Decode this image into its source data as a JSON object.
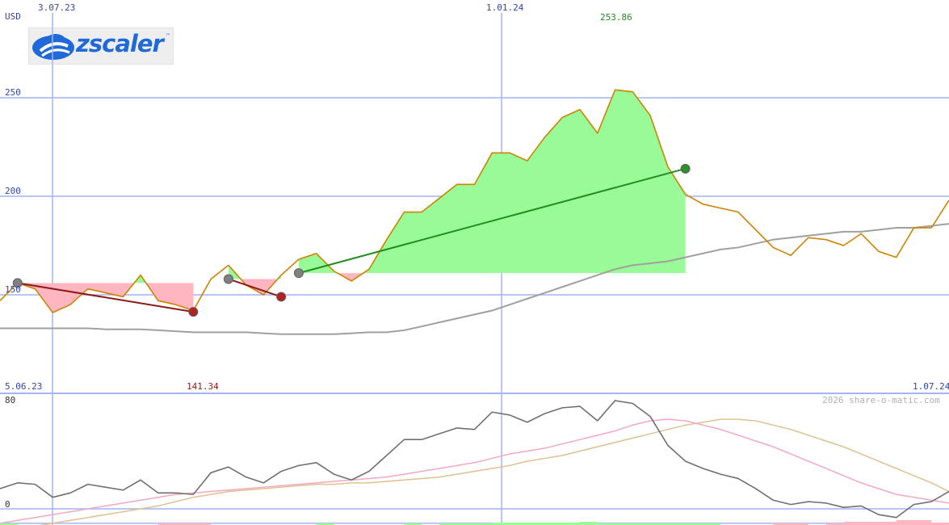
{
  "colors": {
    "price": "#cc8400",
    "gain_fill": "#98fb98",
    "loss_fill": "#ffb6c1",
    "gain_line": "#228b22",
    "loss_line": "#8b1a1a",
    "ma": "#a0a0a0",
    "grid": "#a4b4f4",
    "axis_text": "#3344aa",
    "osc_main": "#707070",
    "osc_pink": "#f4a8c0",
    "osc_tan": "#e0c090"
  },
  "logo": {
    "text": "zscaler",
    "tm": "™",
    "icon": "cloud-logo-icon"
  },
  "labels": {
    "currency": "USD",
    "date_top_left": "3.07.23",
    "date_top_mid": "1.01.24",
    "date_bottom_left": "5.06.23",
    "date_bottom_right": "1.07.24",
    "max_value": "253.86",
    "min_value": "141.34",
    "copyright": "2026 share-o-matic.com"
  },
  "chart_data": [
    {
      "type": "line",
      "title": "",
      "ylabel": "USD",
      "ylim": [
        95,
        297
      ],
      "yticks": [
        150,
        200,
        250
      ],
      "x_date_ticks": [
        "3.07.23",
        "1.01.24"
      ],
      "x_range": [
        "5.06.23",
        "1.07.24"
      ],
      "series": [
        {
          "name": "",
          "role": "price",
          "values": [
            147,
            156,
            153,
            141,
            145,
            153,
            151,
            149,
            160,
            147,
            145,
            142,
            158,
            165,
            155,
            150,
            160,
            168,
            171,
            162,
            157,
            163,
            178,
            192,
            192,
            199,
            206,
            206,
            222,
            222,
            218,
            230,
            240,
            244,
            232,
            254,
            253,
            241,
            215,
            201,
            196,
            194,
            192,
            183,
            174,
            170,
            179,
            178,
            175,
            181,
            172,
            169,
            184,
            184,
            198
          ]
        },
        {
          "name": "",
          "role": "moving-average",
          "values": [
            133,
            133,
            133,
            133,
            133,
            133,
            132.5,
            132.5,
            132.5,
            132,
            131.5,
            131,
            131,
            131,
            131,
            130.5,
            130,
            130,
            130,
            130,
            130.5,
            131,
            131,
            132,
            134,
            136,
            138,
            140,
            142,
            145,
            148,
            151,
            154,
            157,
            160,
            163,
            165,
            166,
            167,
            169,
            171,
            173,
            174,
            176,
            178,
            179,
            180,
            181,
            182,
            182,
            183,
            184,
            184,
            185,
            186
          ]
        }
      ],
      "trades": [
        {
          "from_index": 1,
          "to_index": 11,
          "entry": 156,
          "exit": 141.34,
          "result": "loss"
        },
        {
          "from_index": 13,
          "to_index": 16,
          "entry": 158,
          "exit": 149,
          "result": "loss"
        },
        {
          "from_index": 17,
          "to_index": 39,
          "entry": 161,
          "exit": 214,
          "result": "gain"
        }
      ],
      "annotations": [
        "253.86",
        "141.34"
      ]
    },
    {
      "type": "line",
      "title": "",
      "ylim": [
        -10,
        80
      ],
      "yticks": [
        80,
        0,
        -10
      ],
      "series": [
        {
          "name": "",
          "role": "oscillator",
          "values": [
            14,
            18,
            17,
            8,
            11,
            17,
            15,
            13,
            20,
            11,
            11,
            10,
            25,
            29,
            22,
            18,
            26,
            30,
            32,
            24,
            20,
            26,
            37,
            48,
            48,
            52,
            56,
            55,
            67,
            65,
            60,
            66,
            70,
            71,
            61,
            75,
            73,
            64,
            44,
            33,
            28,
            24,
            21,
            14,
            6,
            3,
            5,
            4,
            1,
            2,
            -4,
            -6,
            3,
            5,
            12
          ]
        },
        {
          "name": "",
          "role": "signal-fast",
          "values": [
            -10,
            -8,
            -6,
            -4,
            -2,
            0,
            2,
            4,
            6,
            8,
            10,
            11,
            12,
            13,
            14,
            15,
            16,
            17,
            18,
            19,
            20,
            21,
            22,
            24,
            26,
            28,
            30,
            32,
            35,
            38,
            40,
            42,
            45,
            48,
            51,
            54,
            58,
            61,
            62,
            61,
            58,
            55,
            51,
            47,
            43,
            38,
            33,
            28,
            23,
            18,
            14,
            10,
            8,
            6,
            4
          ]
        },
        {
          "name": "",
          "role": "signal-slow",
          "values": [
            -15,
            -14,
            -12,
            -10,
            -8,
            -6,
            -4,
            -2,
            0,
            2,
            5,
            8,
            10,
            12,
            13,
            14,
            15,
            16,
            17,
            17,
            18,
            18,
            19,
            20,
            21,
            22,
            24,
            26,
            28,
            30,
            33,
            35,
            37,
            40,
            43,
            46,
            49,
            52,
            55,
            58,
            60,
            62,
            62,
            61,
            58,
            55,
            51,
            47,
            43,
            38,
            33,
            28,
            23,
            18,
            12
          ]
        }
      ],
      "histogram": [
        {
          "from_index": 0,
          "to_index": 1,
          "sign": "pos",
          "value": 2
        },
        {
          "from_index": 9,
          "to_index": 12,
          "sign": "neg",
          "value": 2
        },
        {
          "from_index": 18,
          "to_index": 19,
          "sign": "pos",
          "value": 2
        },
        {
          "from_index": 23,
          "to_index": 24,
          "sign": "pos",
          "value": 2
        },
        {
          "from_index": 25,
          "to_index": 28,
          "sign": "pos",
          "value": 2
        },
        {
          "from_index": 28,
          "to_index": 33,
          "sign": "pos",
          "value": 3
        },
        {
          "from_index": 33,
          "to_index": 34,
          "sign": "pos",
          "value": 4
        },
        {
          "from_index": 34,
          "to_index": 41,
          "sign": "pos",
          "value": 2
        },
        {
          "from_index": 44,
          "to_index": 46,
          "sign": "neg",
          "value": 2
        },
        {
          "from_index": 47,
          "to_index": 48,
          "sign": "neg",
          "value": 2
        },
        {
          "from_index": 48,
          "to_index": 51,
          "sign": "neg",
          "value": 4
        },
        {
          "from_index": 51,
          "to_index": 53,
          "sign": "neg",
          "value": 6
        },
        {
          "from_index": 53,
          "to_index": 54,
          "sign": "neg",
          "value": 3
        }
      ]
    }
  ]
}
